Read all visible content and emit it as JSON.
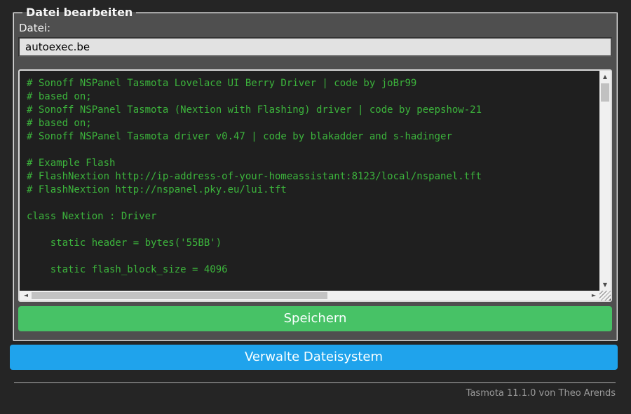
{
  "edit_file": {
    "legend": "Datei bearbeiten",
    "file_label": "Datei:",
    "filename_value": "autoexec.be",
    "editor_lines": [
      "# Sonoff NSPanel Tasmota Lovelace UI Berry Driver | code by joBr99",
      "# based on;",
      "# Sonoff NSPanel Tasmota (Nextion with Flashing) driver | code by peepshow-21",
      "# based on;",
      "# Sonoff NSPanel Tasmota driver v0.47 | code by blakadder and s-hadinger",
      "",
      "# Example Flash",
      "# FlashNextion http://ip-address-of-your-homeassistant:8123/local/nspanel.tft",
      "# FlashNextion http://nspanel.pky.eu/lui.tft",
      "",
      "class Nextion : Driver",
      "",
      "    static header = bytes('55BB')",
      "",
      "    static flash_block_size = 4096"
    ],
    "save_button_label": "Speichern"
  },
  "manage_fs_button_label": "Verwalte Dateisystem",
  "footer": {
    "version_text": "Tasmota 11.1.0 von Theo Arends"
  },
  "icons": {
    "scroll_up": "▲",
    "scroll_down": "▼",
    "scroll_left": "◄",
    "scroll_right": "►"
  },
  "colors": {
    "page_background": "#252525",
    "form_background": "#4f4f4f",
    "editor_background": "#1f1f1f",
    "editor_text": "#3cb43c",
    "input_background": "#e2e2e2",
    "save_button": "#47c266",
    "manage_button": "#1fa3ec",
    "button_text": "#faffff"
  }
}
